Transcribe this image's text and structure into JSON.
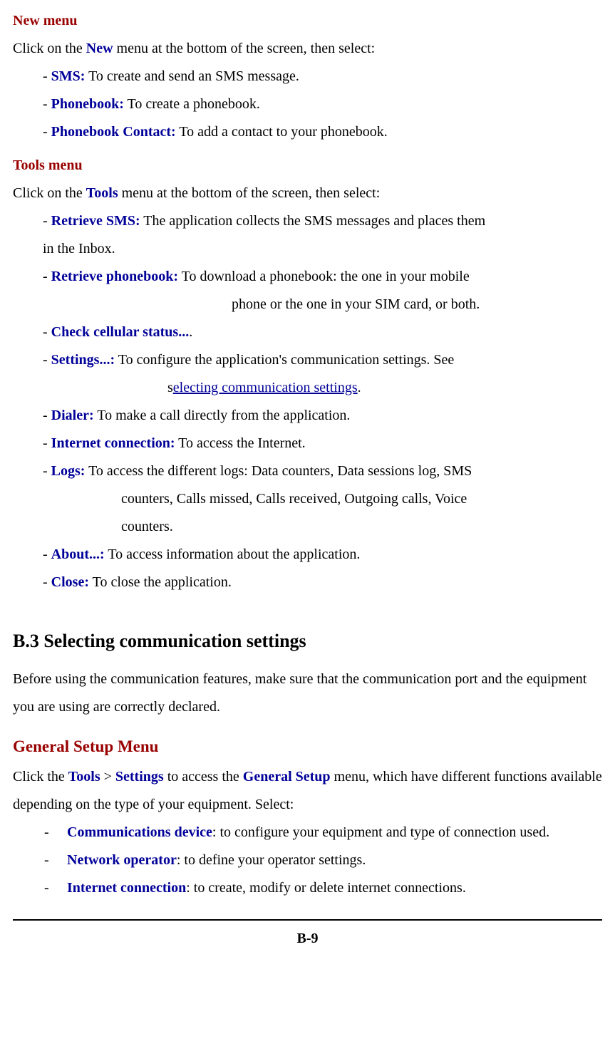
{
  "newMenu": {
    "heading": "New menu",
    "intro_pre": "Click on the ",
    "intro_bold": "New",
    "intro_post": " menu at the bottom of the screen, then select:",
    "sms_label": "SMS:",
    "sms_text": " To create and send an SMS message.",
    "phonebook_label": "Phonebook:",
    "phonebook_text": " To create a phonebook.",
    "phonebook_contact_label": "Phonebook Contact:",
    "phonebook_contact_text": " To add a contact to your phonebook."
  },
  "toolsMenu": {
    "heading": "Tools menu",
    "intro_pre": "Click on the ",
    "intro_bold": "Tools",
    "intro_post": " menu at the bottom of the screen, then select:",
    "retrieve_sms_label": "Retrieve SMS:",
    "retrieve_sms_text": " The application collects the SMS messages and places them",
    "retrieve_sms_text2": "in the Inbox.",
    "retrieve_pb_label": "Retrieve phonebook:",
    "retrieve_pb_text": " To download a phonebook: the one in your mobile",
    "retrieve_pb_text2": "phone or the one in your SIM card, or both.",
    "check_status_label": "Check cellular status...",
    "check_status_dot": ".",
    "settings_label": "Settings...:",
    "settings_text": " To configure the application's communication settings. See",
    "settings_text2_pre": "s",
    "settings_link": "electing communication settings",
    "settings_text2_post": ".",
    "dialer_label": "Dialer:",
    "dialer_text": " To make a call directly from the application.",
    "internet_label": "Internet connection:",
    "internet_text": " To access the Internet.",
    "logs_label": "Logs:",
    "logs_text": " To access the different logs: Data counters, Data sessions log, SMS",
    "logs_text2": "counters, Calls missed, Calls received, Outgoing calls, Voice",
    "logs_text3": "counters.",
    "about_label": "About...:",
    "about_text": " To access information about the application.",
    "close_label": "Close:",
    "close_text": " To close the application."
  },
  "section": {
    "title": "B.3 Selecting communication settings",
    "intro": "Before using the communication features, make sure that the communication port and the equipment you are using are correctly declared."
  },
  "generalSetup": {
    "heading": "General Setup Menu",
    "intro_p1": "Click the ",
    "intro_b1": "Tools",
    "intro_p2": " > ",
    "intro_b2": "Settings",
    "intro_p3": " to access the ",
    "intro_b3": "General Setup",
    "intro_p4": " menu, which have different functions available depending on the type of your equipment. Select:",
    "item1_label": "Communications device",
    "item1_text": ": to configure your equipment and type of connection used.",
    "item2_label": "Network operator",
    "item2_text": ": to define your operator settings.",
    "item3_label": "Internet connection",
    "item3_text": ": to create, modify or delete internet connections."
  },
  "footer": {
    "page": "B-9"
  },
  "dash": "- "
}
